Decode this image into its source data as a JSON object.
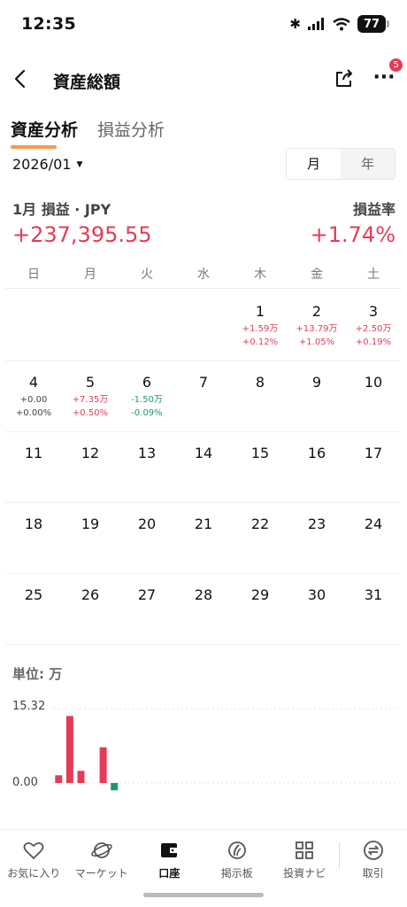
{
  "status": {
    "time": "12:35",
    "battery": "77"
  },
  "header": {
    "title": "資産総額",
    "more_badge": "5"
  },
  "tabs": [
    {
      "label": "資産分析",
      "active": true
    },
    {
      "label": "損益分析",
      "active": false
    }
  ],
  "date_selector": {
    "value": "2026/01"
  },
  "period_toggle": {
    "month": "月",
    "year": "年",
    "selected": "月"
  },
  "summary": {
    "label": "1月 損益 · JPY",
    "value": "+237,395.55",
    "rate_label": "損益率",
    "rate": "+1.74%"
  },
  "weekdays": [
    "日",
    "月",
    "火",
    "水",
    "木",
    "金",
    "土"
  ],
  "calendar": [
    [
      {
        "day": "",
        "pl": "",
        "pct": "",
        "trend": ""
      },
      {
        "day": "",
        "pl": "",
        "pct": "",
        "trend": ""
      },
      {
        "day": "",
        "pl": "",
        "pct": "",
        "trend": ""
      },
      {
        "day": "",
        "pl": "",
        "pct": "",
        "trend": ""
      },
      {
        "day": "1",
        "pl": "+1.59万",
        "pct": "+0.12%",
        "trend": "up"
      },
      {
        "day": "2",
        "pl": "+13.79万",
        "pct": "+1.05%",
        "trend": "up"
      },
      {
        "day": "3",
        "pl": "+2.50万",
        "pct": "+0.19%",
        "trend": "up"
      }
    ],
    [
      {
        "day": "4",
        "pl": "+0.00",
        "pct": "+0.00%",
        "trend": "flat"
      },
      {
        "day": "5",
        "pl": "+7.35万",
        "pct": "+0.50%",
        "trend": "up"
      },
      {
        "day": "6",
        "pl": "-1.50万",
        "pct": "-0.09%",
        "trend": "down"
      },
      {
        "day": "7",
        "pl": "",
        "pct": "",
        "trend": ""
      },
      {
        "day": "8",
        "pl": "",
        "pct": "",
        "trend": ""
      },
      {
        "day": "9",
        "pl": "",
        "pct": "",
        "trend": ""
      },
      {
        "day": "10",
        "pl": "",
        "pct": "",
        "trend": ""
      }
    ],
    [
      {
        "day": "11",
        "pl": "",
        "pct": "",
        "trend": ""
      },
      {
        "day": "12",
        "pl": "",
        "pct": "",
        "trend": ""
      },
      {
        "day": "13",
        "pl": "",
        "pct": "",
        "trend": ""
      },
      {
        "day": "14",
        "pl": "",
        "pct": "",
        "trend": ""
      },
      {
        "day": "15",
        "pl": "",
        "pct": "",
        "trend": ""
      },
      {
        "day": "16",
        "pl": "",
        "pct": "",
        "trend": ""
      },
      {
        "day": "17",
        "pl": "",
        "pct": "",
        "trend": ""
      }
    ],
    [
      {
        "day": "18",
        "pl": "",
        "pct": "",
        "trend": ""
      },
      {
        "day": "19",
        "pl": "",
        "pct": "",
        "trend": ""
      },
      {
        "day": "20",
        "pl": "",
        "pct": "",
        "trend": ""
      },
      {
        "day": "21",
        "pl": "",
        "pct": "",
        "trend": ""
      },
      {
        "day": "22",
        "pl": "",
        "pct": "",
        "trend": ""
      },
      {
        "day": "23",
        "pl": "",
        "pct": "",
        "trend": ""
      },
      {
        "day": "24",
        "pl": "",
        "pct": "",
        "trend": ""
      }
    ],
    [
      {
        "day": "25",
        "pl": "",
        "pct": "",
        "trend": ""
      },
      {
        "day": "26",
        "pl": "",
        "pct": "",
        "trend": ""
      },
      {
        "day": "27",
        "pl": "",
        "pct": "",
        "trend": ""
      },
      {
        "day": "28",
        "pl": "",
        "pct": "",
        "trend": ""
      },
      {
        "day": "29",
        "pl": "",
        "pct": "",
        "trend": ""
      },
      {
        "day": "30",
        "pl": "",
        "pct": "",
        "trend": ""
      },
      {
        "day": "31",
        "pl": "",
        "pct": "",
        "trend": ""
      }
    ]
  ],
  "chart": {
    "unit_label": "単位: 万",
    "y_max_label": "15.32",
    "y_min_label": "0.00"
  },
  "chart_data": {
    "type": "bar",
    "categories": [
      "1",
      "2",
      "3",
      "4",
      "5",
      "6",
      "7",
      "8",
      "9",
      "10",
      "11",
      "12",
      "13",
      "14",
      "15",
      "16",
      "17",
      "18",
      "19",
      "20",
      "21",
      "22",
      "23",
      "24",
      "25",
      "26",
      "27",
      "28",
      "29",
      "30",
      "31"
    ],
    "values": [
      1.59,
      13.79,
      2.5,
      0.0,
      7.35,
      -1.5,
      null,
      null,
      null,
      null,
      null,
      null,
      null,
      null,
      null,
      null,
      null,
      null,
      null,
      null,
      null,
      null,
      null,
      null,
      null,
      null,
      null,
      null,
      null,
      null,
      null
    ],
    "ylim": [
      0,
      15.32
    ],
    "ylabel": "単位: 万",
    "colors": {
      "positive": "#e33c57",
      "negative": "#1a9b6c"
    }
  },
  "bottom_nav": [
    {
      "label": "お気に入り",
      "icon": "heart-icon",
      "active": false
    },
    {
      "label": "マーケット",
      "icon": "planet-icon",
      "active": false
    },
    {
      "label": "口座",
      "icon": "wallet-icon",
      "active": true
    },
    {
      "label": "掲示板",
      "icon": "feed-icon",
      "active": false
    },
    {
      "label": "投資ナビ",
      "icon": "grid-icon",
      "active": false
    },
    {
      "label": "取引",
      "icon": "trade-icon",
      "active": false
    }
  ],
  "colors": {
    "accent": "#e33c57",
    "down": "#1a9b6c",
    "tab_underline": "#f39a52"
  }
}
